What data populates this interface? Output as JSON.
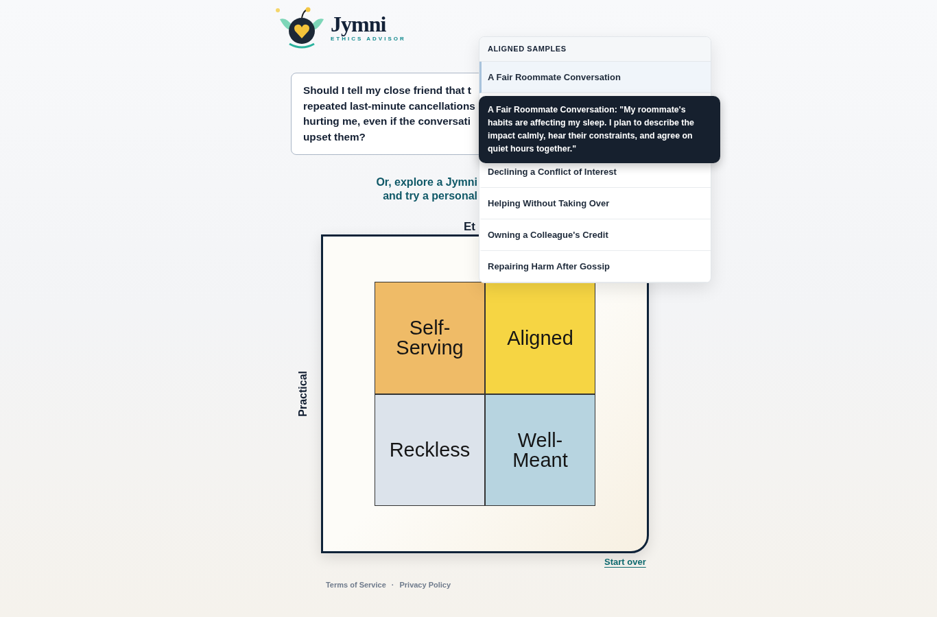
{
  "brand": {
    "name": "Jymni",
    "tagline": "ETHICS ADVISOR"
  },
  "question": {
    "lines": [
      "Should I tell my close friend that t",
      "repeated last-minute cancellations",
      "hurting me, even if the conversati",
      "upset them?"
    ]
  },
  "explore": {
    "lines": [
      "Or, explore a Jymni",
      "and try a personal"
    ]
  },
  "matrix": {
    "x_axis_title": "Et",
    "y_axis_title": "Practical",
    "quadrants": [
      {
        "label": "Self-Serving",
        "color": "#efbb67"
      },
      {
        "label": "Aligned",
        "color": "#f6d543"
      },
      {
        "label": "Reckless",
        "color": "#dce3eb"
      },
      {
        "label": "Well-Meant",
        "color": "#b7d4e0"
      }
    ]
  },
  "start_over": "Start over",
  "footer": {
    "links": [
      "Terms of Service",
      "Privacy Policy"
    ],
    "separator": "·"
  },
  "samples": {
    "title": "ALIGNED SAMPLES",
    "items": [
      {
        "label": "A Fair Roommate Conversation",
        "selected": true
      },
      {
        "label": "Declining a Conflict of Interest",
        "selected": false
      },
      {
        "label": "Helping Without Taking Over",
        "selected": false
      },
      {
        "label": "Owning a Colleague's Credit",
        "selected": false
      },
      {
        "label": "Repairing Harm After Gossip",
        "selected": false
      }
    ]
  },
  "tooltip": {
    "text": "A Fair Roommate Conversation: \"My roommate's habits are affecting my sleep. I plan to describe the impact calmly, hear their constraints, and agree on quiet hours together.\""
  }
}
